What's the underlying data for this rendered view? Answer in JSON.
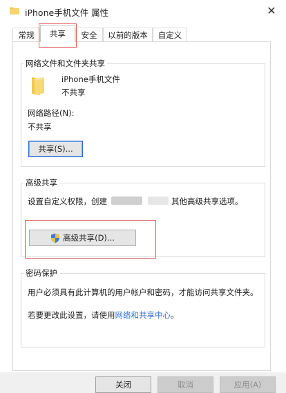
{
  "window": {
    "title": "iPhone手机文件 属性",
    "close_glyph": "✕",
    "icon": "folder-icon"
  },
  "tabs": [
    {
      "label": "常规",
      "active": false
    },
    {
      "label": "共享",
      "active": true
    },
    {
      "label": "安全",
      "active": false
    },
    {
      "label": "以前的版本",
      "active": false
    },
    {
      "label": "自定义",
      "active": false
    }
  ],
  "network_sharing": {
    "title": "网络文件和文件夹共享",
    "folder_name": "iPhone手机文件",
    "folder_status": "不共享",
    "path_label": "网络路径(N):",
    "path_value": "不共享",
    "share_button": "共享(S)..."
  },
  "advanced_sharing": {
    "title": "高级共享",
    "description_part1": "设置自定义权限，创建",
    "description_part2": "其他高级共享选项。",
    "button": "高级共享(D)..."
  },
  "password_protection": {
    "title": "密码保护",
    "description": "用户必须具有此计算机的用户帐户和密码，才能访问共享文件夹。",
    "change_prefix": "若要更改此设置，请使用",
    "link": "网络和共享中心",
    "change_suffix": "。"
  },
  "footer": {
    "close": "关闭",
    "cancel": "取消",
    "apply": "应用(A)"
  },
  "colors": {
    "accent": "#2f6fd0",
    "highlight": "#d85c5c",
    "folder": "#f2cc5a"
  }
}
